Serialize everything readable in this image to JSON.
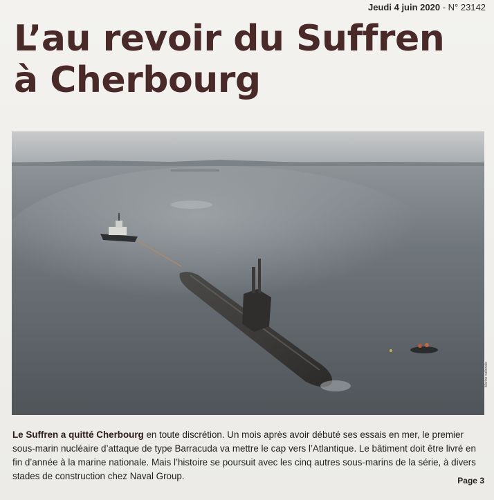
{
  "dateline": {
    "date": "Jeudi 4 juin 2020",
    "separator": " - ",
    "issue": "N° 23142"
  },
  "headline": {
    "line1": "L’au revoir du Suffren",
    "line2": "à Cherbourg"
  },
  "photo": {
    "credit": "Marine nationale"
  },
  "caption": {
    "lead": "Le Suffren a quitté Cherbourg",
    "body": " en toute discrétion. Un mois après avoir débuté ses essais en mer, le premier sous-marin nucléaire d’attaque de type Barracuda va mettre le cap vers l’Atlantique. Le bâtiment doit être livré en fin d’année à la marine nationale. Mais l’histoire se poursuit avec les cinq autres sous-marins de la série, à divers stades de construction chez Naval Group."
  },
  "page_ref": "Page 3",
  "colors": {
    "headline": "#4a2a28",
    "sea": "#5f6469",
    "sky": "#b9bcbf"
  }
}
